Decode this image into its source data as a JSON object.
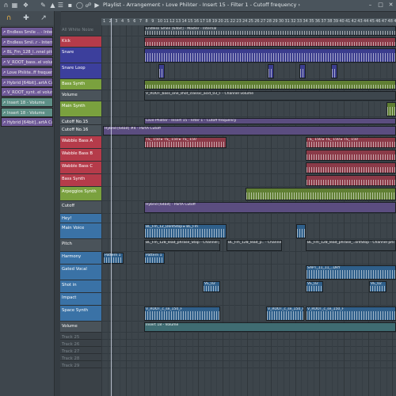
{
  "window": {
    "title": "Playlist - Arrangement › Love Philıter - Insert 15 - Filter 1 - Cutoff frequency ›"
  },
  "icons": [
    "magnet-icon",
    "grid-icon",
    "tool-icon",
    "draw-icon",
    "paint-icon",
    "delete-icon",
    "mute-icon",
    "slice-icon",
    "select-icon",
    "zoom-icon",
    "play-icon"
  ],
  "browser": {
    "items": [
      {
        "label": "Endless Smile .. - Internal",
        "color": "#6f5a98"
      },
      {
        "label": "Endless Smil..r - Internal",
        "color": "#6f5a98"
      },
      {
        "label": "BL_Fm_128_l..nnel pitch",
        "color": "#6f5a98"
      },
      {
        "label": "V_ROOT_bass..el volume",
        "color": "#6f5a98"
      },
      {
        "label": "Love Philıte..ff frequency",
        "color": "#6f5a98"
      },
      {
        "label": "Hybrid [64bit]..artA Cutoff",
        "color": "#6f5a98"
      },
      {
        "label": "V_ROOT_synt..el volume",
        "color": "#6f5a98"
      },
      {
        "label": "Insert 18 - Volume",
        "color": "#5d8f86"
      },
      {
        "label": "Insert 18 - Volume",
        "color": "#5d8f86"
      },
      {
        "label": "Hybrid [64bit]..artA Cutoff",
        "color": "#6f5a98"
      }
    ]
  },
  "ruler": [
    "1",
    "2",
    "3",
    "4",
    "5",
    "6",
    "7",
    "8",
    "9",
    "10",
    "11",
    "12",
    "13",
    "14",
    "15",
    "16",
    "17",
    "18",
    "19",
    "20",
    "21",
    "22",
    "23",
    "24",
    "25",
    "26",
    "27",
    "28",
    "29",
    "30",
    "31",
    "32",
    "33",
    "34",
    "35",
    "36",
    "37",
    "38",
    "39",
    "40",
    "41",
    "42",
    "43",
    "44",
    "45",
    "46",
    "47",
    "48",
    "49"
  ],
  "tracks": [
    {
      "label": "All White Noize",
      "color": "#3a4147",
      "h": 14
    },
    {
      "label": "Kick",
      "color": "#b53b4a",
      "h": 14
    },
    {
      "label": "Snare",
      "color": "#3c3f9c",
      "h": 20
    },
    {
      "label": "Snare Loop",
      "color": "#3c3f9c",
      "h": 20
    },
    {
      "label": "Bass Synth",
      "color": "#7aa13e",
      "h": 14
    },
    {
      "label": "Volume",
      "color": "#4a535a",
      "h": 14
    },
    {
      "label": "Main Synth",
      "color": "#7aa13e",
      "h": 20
    },
    {
      "label": "Cutoff No.15",
      "color": "#4a535a",
      "h": 10
    },
    {
      "label": "Cutoff No.16",
      "color": "#4a535a",
      "h": 14
    },
    {
      "label": "Wabble Bass A",
      "color": "#b53b4a",
      "h": 16
    },
    {
      "label": "Wabble Bass B",
      "color": "#b53b4a",
      "h": 16
    },
    {
      "label": "Wabble Bass C",
      "color": "#b53b4a",
      "h": 16
    },
    {
      "label": "Bass Synth",
      "color": "#b53b4a",
      "h": 16
    },
    {
      "label": "Arpeggios Synth",
      "color": "#7aa13e",
      "h": 18
    },
    {
      "label": "Cutoff",
      "color": "#4a535a",
      "h": 16
    },
    {
      "label": "Hey!",
      "color": "#3a72a6",
      "h": 12
    },
    {
      "label": "Main Voice",
      "color": "#3a72a6",
      "h": 20
    },
    {
      "label": "Pitch",
      "color": "#4a535a",
      "h": 16
    },
    {
      "label": "Harmony",
      "color": "#3a72a6",
      "h": 16
    },
    {
      "label": "Gated Vocal",
      "color": "#3a72a6",
      "h": 20
    },
    {
      "label": "Shot in",
      "color": "#3a72a6",
      "h": 16
    },
    {
      "label": "Impact",
      "color": "#3a72a6",
      "h": 16
    },
    {
      "label": "Space Synth",
      "color": "#3a72a6",
      "h": 20
    },
    {
      "label": "Volume",
      "color": "#4a535a",
      "h": 14
    },
    {
      "label": "Track 25",
      "color": "#3a4147",
      "h": 9
    },
    {
      "label": "Track 26",
      "color": "#3a4147",
      "h": 9
    },
    {
      "label": "Track 27",
      "color": "#3a4147",
      "h": 9
    },
    {
      "label": "Track 28",
      "color": "#3a4147",
      "h": 9
    },
    {
      "label": "Track 29",
      "color": "#3a4147",
      "h": 9
    }
  ],
  "clips": {
    "endless_master": "Endless Smile [64bit] - Master - Internal",
    "bass_volume": "V_ROOT_bass_one_shot_classic_acid_03_F - Channel volume",
    "cutoff_freq": "Love Philıter - Insert 15 - Filter 1 - Cutoff frequency",
    "hybrid_partb": "Hybrid [64bit] #4 - PartA Cutoff",
    "ts150": "TS_ 150 ▸ TS_ 150 ▸ TS_ 150",
    "hybrid_parta": "Hybrid [64bit] - PartA Cutoff",
    "main_voice": "BL_Fm_12_DontStop ▸ BL_Fm",
    "pitch1": "BL_Fm_128_lead_phrase_Stop - Channel pitch",
    "pitch2": "BL_Fm_128_lead_p.. - Channel pitch",
    "pitch3": "BL_Fm_128_lead_phrase_..ontStop - Channel pitch",
    "pattern1": "Pattern 1",
    "gated": "SAPT_11_11_..DRY",
    "shot": "VE_02",
    "space": "V_ROOT_c_se_150_F",
    "insert18": "Insert 18 - Volume"
  }
}
